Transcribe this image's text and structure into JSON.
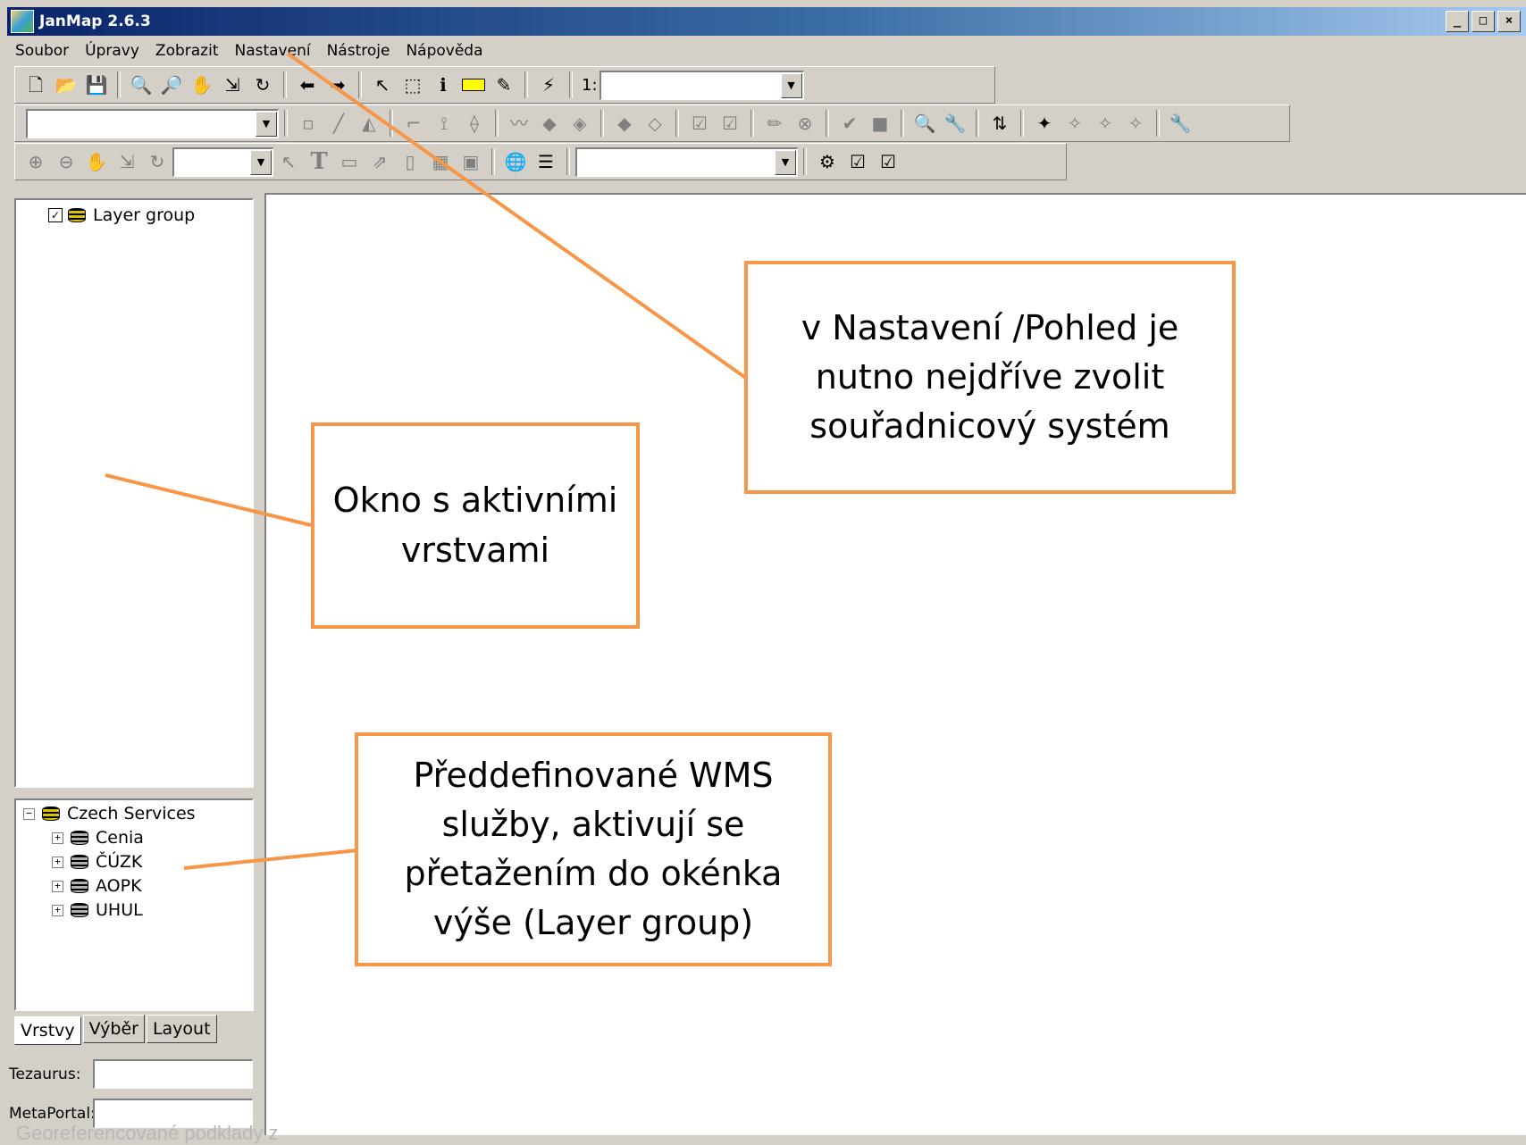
{
  "window": {
    "title": "JanMap 2.6.3",
    "controls": [
      "_",
      "□",
      "×"
    ]
  },
  "menu": [
    "Soubor",
    "Úpravy",
    "Zobrazit",
    "Nastavení",
    "Nástroje",
    "Nápověda"
  ],
  "toolbar": {
    "scale_prefix": "1:",
    "scale_value": ""
  },
  "layers": {
    "root": "Layer group",
    "root_checked": "✓"
  },
  "services": {
    "root": "Czech Services",
    "items": [
      "Cenia",
      "ČÚZK",
      "AOPK",
      "UHUL"
    ],
    "collapse": "−",
    "expand": "+"
  },
  "tabs": [
    "Vrstvy",
    "Výběr",
    "Layout"
  ],
  "fields": {
    "tezaurus_label": "Tezaurus:",
    "metaportal_label": "MetaPortal:"
  },
  "callouts": {
    "settings_note": "v Nastavení /Pohled je\nnutno nejdříve zvolit\nsouřadnicový systém",
    "layers_note": "Okno s aktivními\nvrstvami",
    "wms_note": "Předdefinované WMS\nslužby, aktivují se\npřetažením do okénka\nvýše (Layer group)"
  },
  "footer_text": "Georeferencované podklady z",
  "colors": {
    "callout_border": "#f79646",
    "titlebar": "#0a246a",
    "chrome": "#d4d0c8"
  }
}
